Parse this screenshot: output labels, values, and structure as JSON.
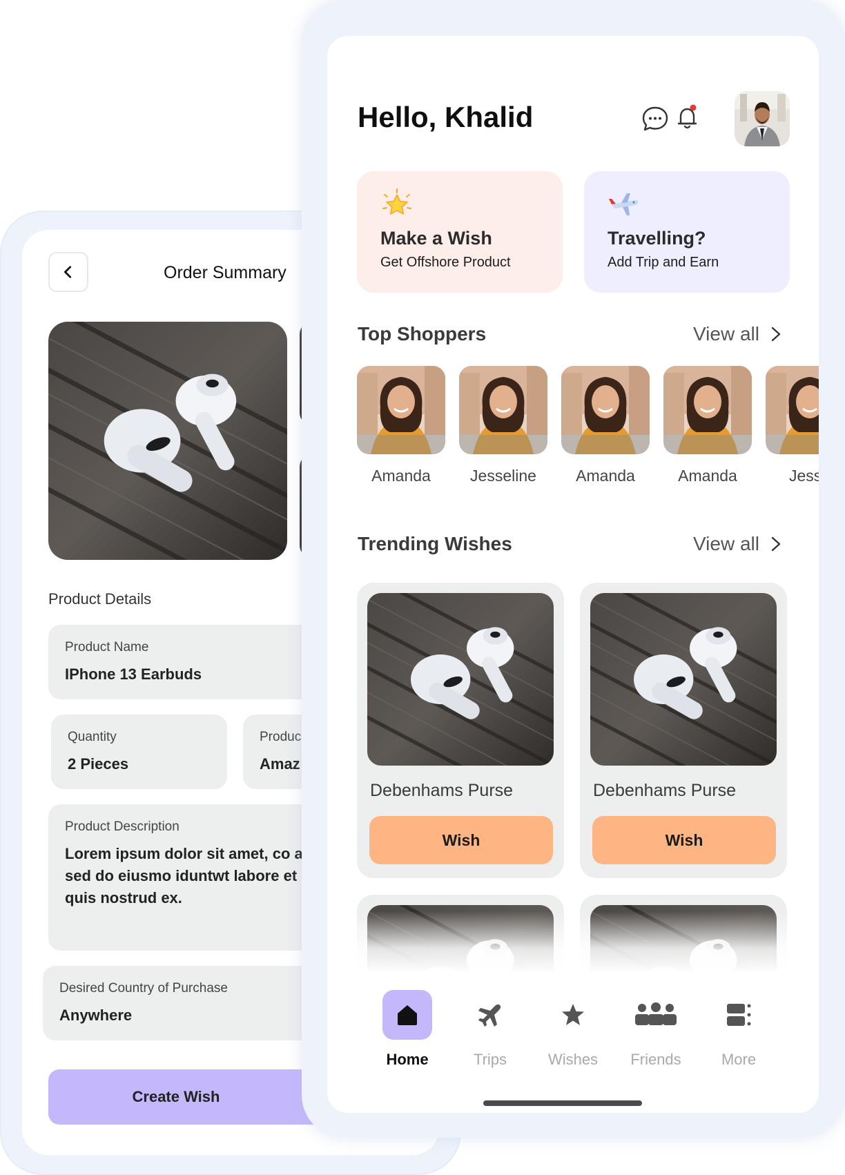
{
  "order_summary": {
    "title": "Order Summary",
    "section_label": "Product Details",
    "fields": {
      "product_name": {
        "label": "Product Name",
        "value": "IPhone 13 Earbuds"
      },
      "quantity": {
        "label": "Quantity",
        "value": "2 Pieces"
      },
      "product_source": {
        "label": "Produc",
        "value": "Amaz"
      },
      "description": {
        "label": "Product Description",
        "value": "Lorem ipsum dolor sit amet, co adipiscing elit, sed do eiusmo iduntwt labore et dolore magr quis nostrud ex."
      },
      "country": {
        "label": "Desired Country of Purchase",
        "value": "Anywhere"
      }
    },
    "create_button": "Create Wish"
  },
  "home": {
    "greeting": "Hello, Khalid",
    "cards": [
      {
        "title": "Make a Wish",
        "subtitle": "Get Offshore Product",
        "icon": "star-icon"
      },
      {
        "title": "Travelling?",
        "subtitle": "Add Trip and Earn",
        "icon": "airplane-icon"
      }
    ],
    "top_shoppers": {
      "title": "Top Shoppers",
      "view_all": "View all",
      "people": [
        "Amanda",
        "Jesseline",
        "Amanda",
        "Amanda",
        "Jesse"
      ]
    },
    "trending_wishes": {
      "title": "Trending Wishes",
      "view_all": "View all",
      "items": [
        {
          "name": "Debenhams Purse",
          "button": "Wish"
        },
        {
          "name": "Debenhams Purse",
          "button": "Wish"
        }
      ]
    },
    "tabs": [
      {
        "label": "Home",
        "icon": "home-icon",
        "active": true
      },
      {
        "label": "Trips",
        "icon": "plane-icon",
        "active": false
      },
      {
        "label": "Wishes",
        "icon": "star-icon",
        "active": false
      },
      {
        "label": "Friends",
        "icon": "people-icon",
        "active": false
      },
      {
        "label": "More",
        "icon": "more-icon",
        "active": false
      }
    ],
    "colors": {
      "accent_purple": "#c4b8fb",
      "wish_orange": "#fdb683",
      "card_pink": "#fdeeea",
      "card_lavender": "#efeefe",
      "notification_red": "#e53935"
    }
  }
}
